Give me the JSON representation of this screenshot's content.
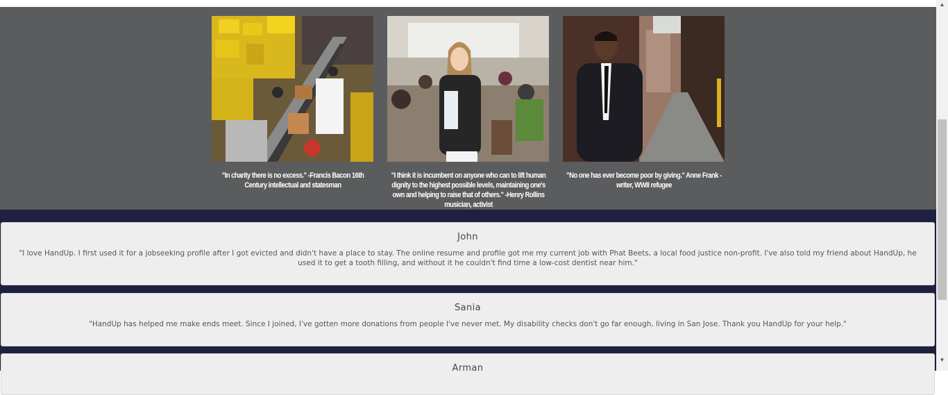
{
  "gallery": {
    "items": [
      {
        "caption": "\"In charity there is no excess.\" -Francis Bacon 16th Century intellectual and statesman"
      },
      {
        "caption": "\"I think it is incumbent on anyone who can to lift human dignity to the highest possible levels, maintaining one's own and helping to raise that of others.\" -Henry Rollins musician, activist"
      },
      {
        "caption": "\"No one has ever become poor by giving.\" Anne Frank - writer, WWII refugee"
      }
    ]
  },
  "testimonials": [
    {
      "name": "John",
      "quote": "\"I love HandUp. I first used it for a jobseeking profile after I got evicted and didn't have a place to stay. The online resume and profile got me my current job with Phat Beets, a local food justice non-profit. I've also told my friend about HandUp, he used it to get a tooth filling, and without it he couldn't find time a low-cost dentist near him.\""
    },
    {
      "name": "Sania",
      "quote": "\"HandUp has helped me make ends meet. Since I joined, I've gotten more donations from people I've never met. My disability checks don't go far enough, living in San Jose. Thank you HandUp for your help.\""
    },
    {
      "name": "Arman",
      "quote": ""
    }
  ],
  "scrollbar": {
    "up_glyph": "▲",
    "down_glyph": "▼"
  }
}
